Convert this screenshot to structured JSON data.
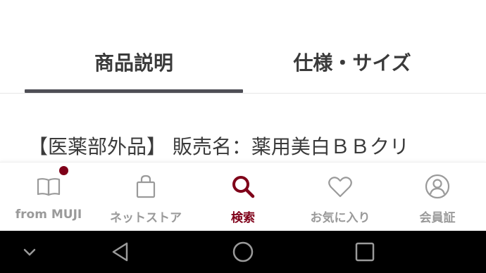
{
  "tabs": [
    {
      "label": "商品説明",
      "active": true
    },
    {
      "label": "仕様・サイズ",
      "active": false
    }
  ],
  "description": "【医薬部外品】 販売名：薬用美白ＢＢクリ",
  "bottom_nav": {
    "items": [
      {
        "label": "from MUJI",
        "icon": "book-icon",
        "has_badge": true
      },
      {
        "label": "ネットストア",
        "icon": "shopping-bag-icon"
      },
      {
        "label": "検索",
        "icon": "search-icon",
        "active": true
      },
      {
        "label": "お気に入り",
        "icon": "heart-icon"
      },
      {
        "label": "会員証",
        "icon": "member-card-icon"
      }
    ],
    "accent_color": "#7f0019",
    "inactive_color": "#9a9a9a"
  },
  "system_nav": {
    "buttons": [
      "chevron-down-icon",
      "back-icon",
      "home-icon",
      "recents-icon"
    ],
    "background": "#000000"
  }
}
